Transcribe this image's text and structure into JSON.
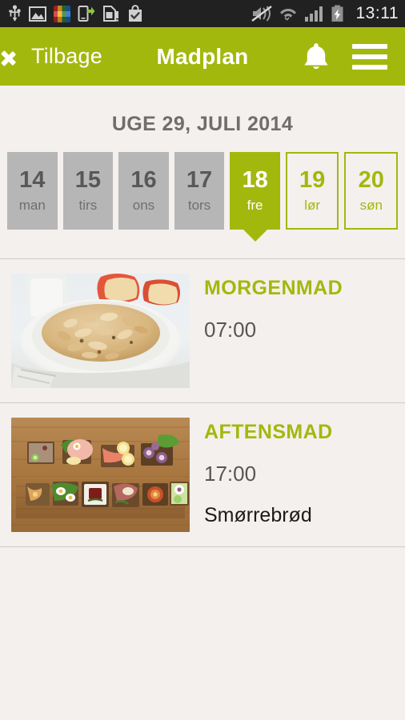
{
  "statusbar": {
    "time": "13:11",
    "left_icons": [
      {
        "name": "usb-icon",
        "glyph": "Ψ"
      },
      {
        "name": "screenshot-image-icon",
        "glyph": "⛰"
      },
      {
        "name": "vandinn-app-icon",
        "glyph": ""
      },
      {
        "name": "phone-transfer-icon",
        "glyph": ""
      },
      {
        "name": "sim-card-icon",
        "glyph": ""
      },
      {
        "name": "shopping-bag-check-icon",
        "glyph": ""
      }
    ],
    "right_icons": [
      {
        "name": "sound-muted-icon"
      },
      {
        "name": "wifi-icon"
      },
      {
        "name": "signal-bars-icon"
      },
      {
        "name": "battery-charging-icon"
      }
    ]
  },
  "header": {
    "back_label": "Tilbage",
    "title": "Madplan",
    "bell_icon": "notifications-bell-icon",
    "menu_icon": "hamburger-menu-icon",
    "accent_color": "#a3b80d"
  },
  "week": {
    "title": "UGE 29, JULI 2014",
    "days": [
      {
        "num": "14",
        "abbr": "man",
        "state": "past"
      },
      {
        "num": "15",
        "abbr": "tirs",
        "state": "past"
      },
      {
        "num": "16",
        "abbr": "ons",
        "state": "past"
      },
      {
        "num": "17",
        "abbr": "tors",
        "state": "past"
      },
      {
        "num": "18",
        "abbr": "fre",
        "state": "today"
      },
      {
        "num": "19",
        "abbr": "lør",
        "state": "future"
      },
      {
        "num": "20",
        "abbr": "søn",
        "state": "future"
      }
    ]
  },
  "meals": [
    {
      "name": "MORGENMAD",
      "time": "07:00",
      "description": "",
      "image_name": "muesli-bowl-with-apple-photo"
    },
    {
      "name": "AFTENSMAD",
      "time": "17:00",
      "description": "Smørrebrød",
      "image_name": "smorrebrod-board-photo"
    }
  ],
  "colors": {
    "accent_green": "#a3b80d",
    "page_background": "#f4f0ed",
    "past_day_gray": "#b6b6b6",
    "status_bar": "#212121"
  }
}
